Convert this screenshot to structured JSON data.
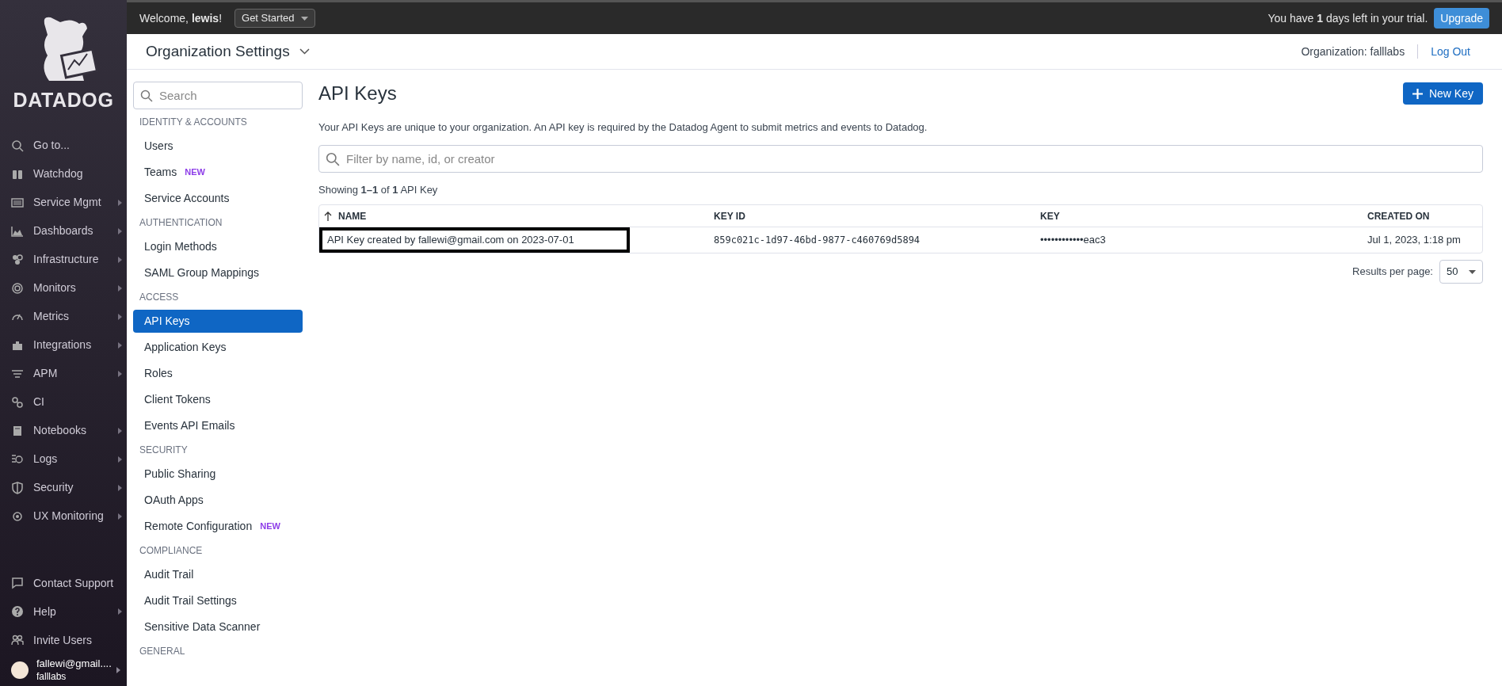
{
  "brand": "DATADOG",
  "nav": {
    "items": [
      {
        "label": "Go to...",
        "submenu": false
      },
      {
        "label": "Watchdog",
        "submenu": false
      },
      {
        "label": "Service Mgmt",
        "submenu": true
      },
      {
        "label": "Dashboards",
        "submenu": true
      },
      {
        "label": "Infrastructure",
        "submenu": true
      },
      {
        "label": "Monitors",
        "submenu": true
      },
      {
        "label": "Metrics",
        "submenu": true
      },
      {
        "label": "Integrations",
        "submenu": true
      },
      {
        "label": "APM",
        "submenu": true
      },
      {
        "label": "CI",
        "submenu": false
      },
      {
        "label": "Notebooks",
        "submenu": true
      },
      {
        "label": "Logs",
        "submenu": true
      },
      {
        "label": "Security",
        "submenu": true
      },
      {
        "label": "UX Monitoring",
        "submenu": true
      }
    ],
    "bottom_items": [
      {
        "label": "Contact Support",
        "submenu": false
      },
      {
        "label": "Help",
        "submenu": true
      },
      {
        "label": "Invite Users",
        "submenu": false
      }
    ],
    "user": {
      "name": "fallewi@gmail....",
      "org": "falllabs"
    }
  },
  "top_bar": {
    "welcome": "Welcome, **lewis**!",
    "get_started": "Get Started",
    "trial": "You have **1** days left in your trial.",
    "upgrade": "Upgrade"
  },
  "header": {
    "title": "Organization Settings",
    "organization": "Organization: falllabs",
    "logout": "Log Out"
  },
  "settings_nav": {
    "search_placeholder": "Search",
    "sections": [
      {
        "title": "IDENTITY & ACCOUNTS",
        "items": [
          {
            "label": "Users",
            "selected": false
          },
          {
            "label": "Teams",
            "badge": "NEW",
            "selected": false
          },
          {
            "label": "Service Accounts",
            "selected": false
          }
        ]
      },
      {
        "title": "AUTHENTICATION",
        "items": [
          {
            "label": "Login Methods",
            "selected": false
          },
          {
            "label": "SAML Group Mappings",
            "selected": false
          }
        ]
      },
      {
        "title": "ACCESS",
        "items": [
          {
            "label": "API Keys",
            "selected": true
          },
          {
            "label": "Application Keys",
            "selected": false
          },
          {
            "label": "Roles",
            "selected": false
          },
          {
            "label": "Client Tokens",
            "selected": false
          },
          {
            "label": "Events API Emails",
            "selected": false
          }
        ]
      },
      {
        "title": "SECURITY",
        "items": [
          {
            "label": "Public Sharing",
            "selected": false
          },
          {
            "label": "OAuth Apps",
            "selected": false
          },
          {
            "label": "Remote Configuration",
            "badge": "NEW",
            "selected": false
          }
        ]
      },
      {
        "title": "COMPLIANCE",
        "items": [
          {
            "label": "Audit Trail",
            "selected": false
          },
          {
            "label": "Audit Trail Settings",
            "selected": false
          },
          {
            "label": "Sensitive Data Scanner",
            "selected": false
          }
        ]
      },
      {
        "title": "GENERAL"
      }
    ]
  },
  "main": {
    "title": "API Keys",
    "new_key": "New Key",
    "description": "Your API Keys are unique to your organization. An API key is required by the Datadog Agent to submit metrics and events to Datadog.",
    "filter_placeholder": "Filter by name, id, or creator",
    "showing": "Showing **1–1** of **1** API Key",
    "table": {
      "columns": [
        "NAME",
        "KEY ID",
        "KEY",
        "CREATED ON"
      ],
      "rows": [
        {
          "cells": [
            "API Key created by fallewi@gmail.com on 2023-07-01",
            "859c021c-1d97-46bd-9877-c460769d5894",
            "••••••••••••eac3",
            "Jul 1, 2023, 1:18 pm"
          ],
          "highlighted": true
        }
      ]
    },
    "results_label": "Results per page:",
    "results_value": "50"
  }
}
